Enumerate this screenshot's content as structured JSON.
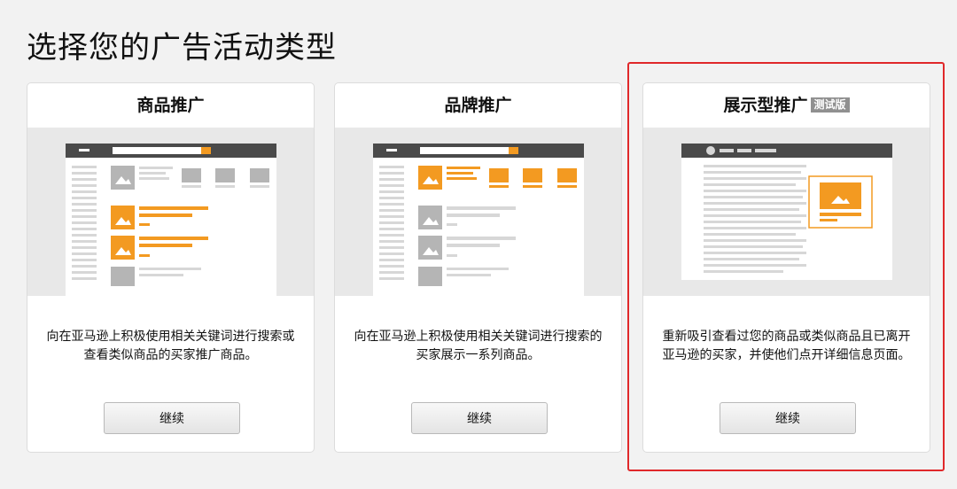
{
  "page": {
    "title": "选择您的广告活动类型"
  },
  "cards": [
    {
      "title": "商品推广",
      "description": "向在亚马逊上积极使用相关关键词进行搜索或查看类似商品的买家推广商品。",
      "button_label": "继续"
    },
    {
      "title": "品牌推广",
      "description": "向在亚马逊上积极使用相关关键词进行搜索的买家展示一系列商品。",
      "button_label": "继续"
    },
    {
      "title": "展示型推广",
      "badge": "测试版",
      "description": "重新吸引查看过您的商品或类似商品且已离开亚马逊的买家，并使他们点开详细信息页面。",
      "button_label": "继续",
      "highlighted": true
    }
  ],
  "colors": {
    "accent": "#f39a21",
    "highlight_border": "#e0282a",
    "preview_bg": "#e8e8e8",
    "mock_header": "#4a4a4a"
  }
}
